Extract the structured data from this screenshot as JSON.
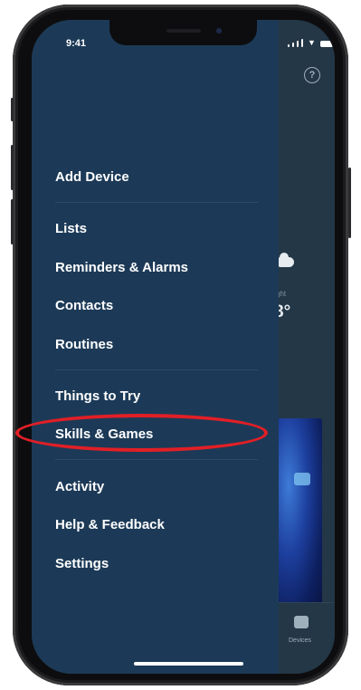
{
  "status_bar": {
    "time": "9:41"
  },
  "menu": {
    "items": [
      {
        "label": "Add Device"
      },
      {
        "label": "Lists"
      },
      {
        "label": "Reminders & Alarms"
      },
      {
        "label": "Contacts"
      },
      {
        "label": "Routines"
      },
      {
        "label": "Things to Try"
      },
      {
        "label": "Skills & Games"
      },
      {
        "label": "Activity"
      },
      {
        "label": "Help & Feedback"
      },
      {
        "label": "Settings"
      }
    ]
  },
  "background": {
    "help_icon": "?",
    "weather_sub": "ght",
    "weather_temp": "8°",
    "devices_label": "Devices"
  },
  "annotation": {
    "color": "#e11f26",
    "highlighted_item": "Skills & Games"
  },
  "colors": {
    "drawer": "#1c3a57",
    "background_app": "#243746"
  }
}
